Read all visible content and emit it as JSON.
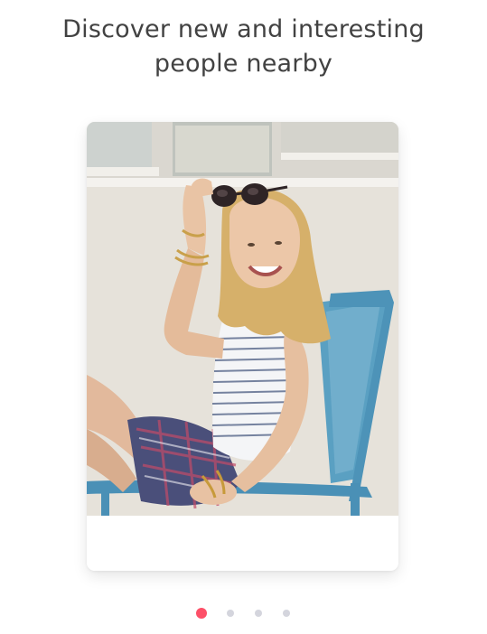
{
  "onboarding": {
    "headline_line1": "Discover new and interesting",
    "headline_line2": "people nearby"
  },
  "card": {
    "photo_description": "Smiling woman with sunglasses on head sitting in a blue chair"
  },
  "pager": {
    "total_pages": 4,
    "current_page": 1
  },
  "colors": {
    "accent": "#fd5068",
    "dot_inactive": "#d4d5dd",
    "headline_text": "#424242"
  }
}
